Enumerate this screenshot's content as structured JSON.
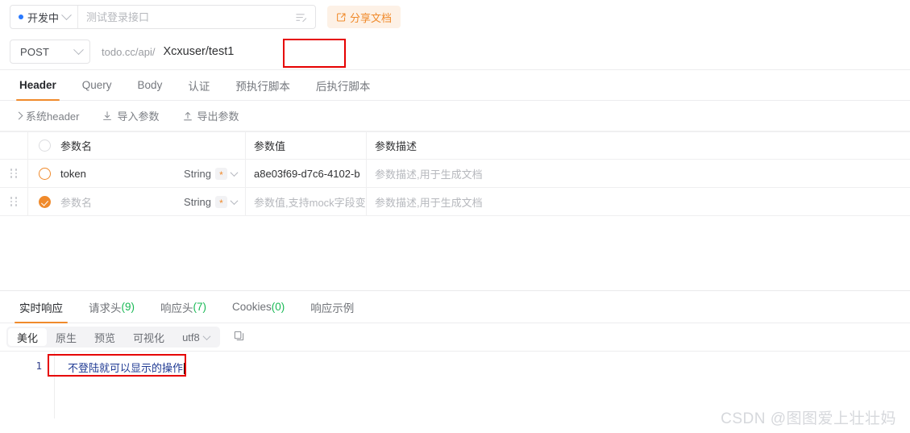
{
  "topbar": {
    "status_label": "开发中",
    "status_dot_color": "#2979ff",
    "name_value": "",
    "name_placeholder": "测试登录接口",
    "lines_icon": "list-lines-icon",
    "share_label": "分享文档",
    "share_icon": "share-box-icon",
    "share_color": "#f08a2b"
  },
  "url_row": {
    "method": "POST",
    "url_prefix": "todo.cc/api/",
    "url_path": "Xcxuser/test1",
    "highlight_color": "#e60000"
  },
  "request_tabs": [
    {
      "label": "Header",
      "active": true
    },
    {
      "label": "Query",
      "active": false
    },
    {
      "label": "Body",
      "active": false
    },
    {
      "label": "认证",
      "active": false
    },
    {
      "label": "预执行脚本",
      "active": false
    },
    {
      "label": "后执行脚本",
      "active": false
    }
  ],
  "param_tools": [
    {
      "label": "系统header",
      "icon": "chevron-right-icon"
    },
    {
      "label": "导入参数",
      "icon": "import-down-icon"
    },
    {
      "label": "导出参数",
      "icon": "export-up-icon"
    }
  ],
  "param_table": {
    "headers": {
      "name": "参数名",
      "value": "参数值",
      "desc": "参数描述"
    },
    "rows": [
      {
        "checked": "empty",
        "name": "token",
        "name_is_placeholder": false,
        "type": "String",
        "required_mark": "*",
        "value": "a8e03f69-d7c6-4102-b",
        "value_is_placeholder": false,
        "desc": "参数描述,用于生成文档",
        "desc_is_placeholder": true
      },
      {
        "checked": "checked",
        "name": "参数名",
        "name_is_placeholder": true,
        "type": "String",
        "required_mark": "*",
        "value": "参数值,支持mock字段变量",
        "value_is_placeholder": true,
        "desc": "参数描述,用于生成文档",
        "desc_is_placeholder": true
      }
    ]
  },
  "response_tabs": [
    {
      "label": "实时响应",
      "count": "",
      "active": true
    },
    {
      "label": "请求头",
      "count": "(9)",
      "active": false
    },
    {
      "label": "响应头",
      "count": "(7)",
      "active": false
    },
    {
      "label": "Cookies",
      "count": "(0)",
      "active": false
    },
    {
      "label": "响应示例",
      "count": "",
      "active": false
    }
  ],
  "format_tools": {
    "segments": [
      {
        "label": "美化",
        "active": true
      },
      {
        "label": "原生",
        "active": false
      },
      {
        "label": "预览",
        "active": false
      },
      {
        "label": "可视化",
        "active": false
      }
    ],
    "encoding": "utf8",
    "copy_icon": "copy-icon"
  },
  "editor": {
    "line_number": "1",
    "content": "不登陆就可以显示的操作",
    "highlight_color": "#e60000"
  },
  "watermark": "CSDN @图图爱上壮壮妈"
}
